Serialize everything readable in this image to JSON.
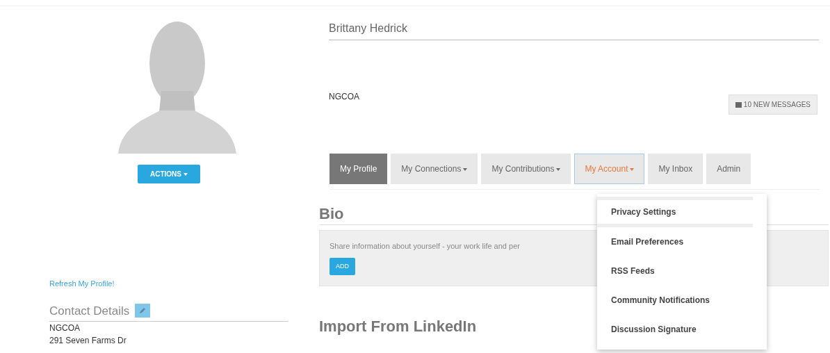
{
  "sidebar": {
    "actions_button": "ACTIONS",
    "refresh_link": "Refresh My Profile!",
    "contact_heading": "Contact Details",
    "contact_lines": [
      "NGCOA",
      "291 Seven Farms Dr"
    ]
  },
  "profile": {
    "name": "Brittany Hedrick",
    "organization": "NGCOA",
    "messages_button": "10 NEW MESSAGES"
  },
  "tabs": [
    {
      "label": "My Profile",
      "kind": "link",
      "selected": true,
      "expanded": false
    },
    {
      "label": "My Connections",
      "kind": "dropdown",
      "selected": false,
      "expanded": false
    },
    {
      "label": "My Contributions",
      "kind": "dropdown",
      "selected": false,
      "expanded": false
    },
    {
      "label": "My Account",
      "kind": "dropdown",
      "selected": false,
      "expanded": true
    },
    {
      "label": "My Inbox",
      "kind": "link",
      "selected": false,
      "expanded": false
    },
    {
      "label": "Admin",
      "kind": "link",
      "selected": false,
      "expanded": false
    }
  ],
  "account_menu": [
    {
      "label": "Privacy Settings",
      "selected": true
    },
    {
      "label": "Email Preferences",
      "selected": false
    },
    {
      "label": "RSS Feeds",
      "selected": false
    },
    {
      "label": "Community Notifications",
      "selected": false
    },
    {
      "label": "Discussion Signature",
      "selected": false
    }
  ],
  "bio": {
    "heading": "Bio",
    "text": "Share information about yourself - your work life and per",
    "add_button": "ADD"
  },
  "linkedin": {
    "heading": "Import From LinkedIn"
  }
}
